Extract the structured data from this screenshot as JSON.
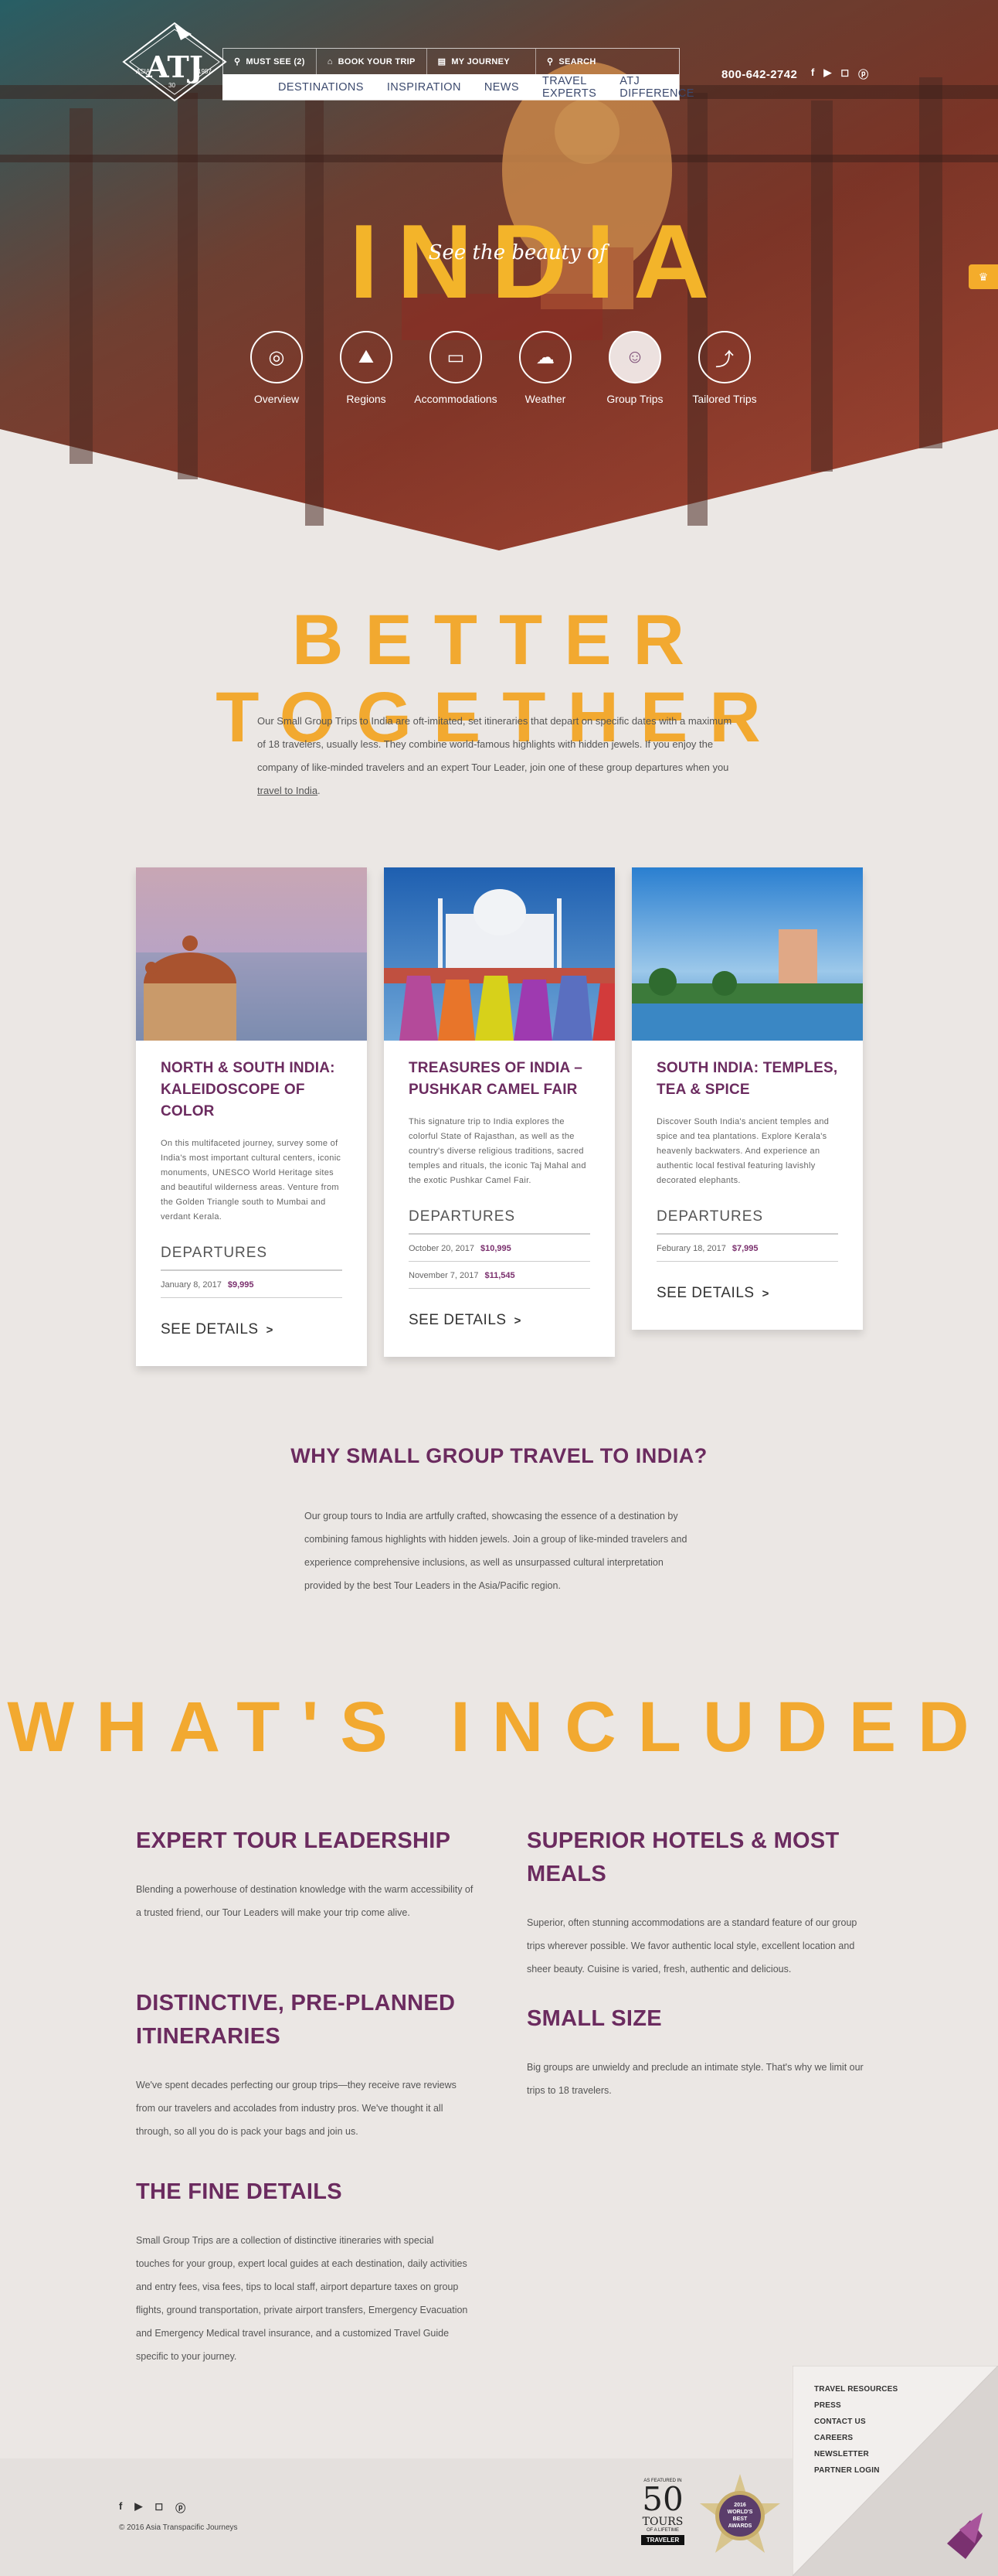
{
  "nav": {
    "top": [
      "MUST SEE (2)",
      "BOOK YOUR TRIP",
      "MY JOURNEY"
    ],
    "search_label": "SEARCH",
    "main": [
      "DESTINATIONS",
      "INSPIRATION",
      "NEWS",
      "TRAVEL EXPERTS",
      "ATJ DIFFERENCE"
    ]
  },
  "logo": {
    "text": "ATJ",
    "left": "ASIA",
    "right": "1987",
    "bottom": "30"
  },
  "phone": "800-642-2742",
  "hero": {
    "title": "INDIA",
    "subtitle": "See the beauty of",
    "icons": [
      {
        "label": "Overview",
        "icon": "globe-icon",
        "glyph": "◎"
      },
      {
        "label": "Regions",
        "icon": "mountains-icon",
        "glyph": "⛰"
      },
      {
        "label": "Accommodations",
        "icon": "bed-icon",
        "glyph": "▭"
      },
      {
        "label": "Weather",
        "icon": "cloud-sun-icon",
        "glyph": "☁"
      },
      {
        "label": "Group Trips",
        "icon": "group-icon",
        "glyph": "☺"
      },
      {
        "label": "Tailored Trips",
        "icon": "route-icon",
        "glyph": "⤴"
      }
    ]
  },
  "better": {
    "heading": "BETTER TOGETHER",
    "text": "Our Small Group Trips to India are oft-imitated, set itineraries that depart on specific dates with a maximum of 18 travelers, usually less. They combine world-famous highlights with hidden jewels. If you enjoy the company of like-minded travelers and an expert Tour Leader, join one of these group departures when you",
    "link": "travel to India",
    "end": "."
  },
  "cards": [
    {
      "title": "NORTH & SOUTH INDIA: KALEIDOSCOPE OF COLOR",
      "text": "On this multifaceted journey, survey some of India's most important cultural centers, iconic monuments, UNESCO World Heritage sites and beautiful wilderness areas. Venture from the Golden Triangle south to Mumbai and verdant Kerala.",
      "departures_label": "DEPARTURES",
      "departures": [
        {
          "date": "January 8, 2017",
          "price": "$9,995"
        }
      ],
      "cta": "SEE DETAILS"
    },
    {
      "title": "TREASURES OF INDIA – PUSHKAR CAMEL FAIR",
      "text": "This signature trip to India explores the colorful State of Rajasthan, as well as the country's diverse religious traditions, sacred temples and rituals, the iconic Taj Mahal and the exotic Pushkar Camel Fair.",
      "departures_label": "DEPARTURES",
      "departures": [
        {
          "date": "October 20, 2017",
          "price": "$10,995"
        },
        {
          "date": "November 7, 2017",
          "price": "$11,545"
        }
      ],
      "cta": "SEE DETAILS"
    },
    {
      "title": "SOUTH INDIA: TEMPLES, TEA & SPICE",
      "text": "Discover South India's ancient temples and spice and tea plantations. Explore Kerala's heavenly backwaters. And experience an authentic local festival featuring lavishly decorated elephants.",
      "departures_label": "DEPARTURES",
      "departures": [
        {
          "date": "Feburary 18, 2017",
          "price": "$7,995"
        }
      ],
      "cta": "SEE DETAILS"
    }
  ],
  "why": {
    "heading": "WHY SMALL GROUP TRAVEL TO INDIA?",
    "text": "Our group tours to India are artfully crafted, showcasing the essence of a destination by combining famous highlights with hidden jewels. Join a group of like-minded travelers and experience comprehensive inclusions, as well as unsurpassed cultural interpretation provided by the best Tour Leaders in the Asia/Pacific region."
  },
  "included": {
    "heading": "WHAT'S INCLUDED",
    "items": [
      {
        "title": "EXPERT TOUR LEADERSHIP",
        "text": "Blending a powerhouse of destination knowledge with the warm accessibility of a trusted friend, our Tour Leaders will make your trip come alive."
      },
      {
        "title": "SUPERIOR HOTELS & MOST MEALS",
        "text": "Superior, often stunning accommodations are a standard feature of our group trips wherever possible. We favor authentic local style, excellent location and sheer beauty. Cuisine is varied, fresh, authentic and delicious."
      },
      {
        "title": "DISTINCTIVE, PRE-PLANNED ITINERARIES",
        "text": "We've spent decades perfecting our group trips—they receive rave reviews from our travelers and accolades from industry pros. We've thought it all through, so all you do is pack your bags and join us."
      },
      {
        "title": "SMALL SIZE",
        "text": "Big groups are unwieldy and preclude an intimate style. That's why we limit our trips to 18 travelers."
      },
      {
        "title": "THE FINE DETAILS",
        "text": "Small Group Trips are a collection of distinctive itineraries with special touches for your group, expert local guides at each destination, daily activities and entry fees, visa fees, tips to local staff, airport departure taxes on group flights, ground transportation, private airport transfers, Emergency Evacuation and Emergency Medical travel insurance, and a customized Travel Guide specific to your journey."
      }
    ]
  },
  "footer": {
    "copyright": "© 2016 Asia Transpacific Journeys",
    "links": [
      "TRAVEL RESOURCES",
      "PRESS",
      "CONTACT US",
      "CAREERS",
      "NEWSLETTER",
      "PARTNER LOGIN"
    ],
    "badge_top": "AS FEATURED IN",
    "badge_num": "50",
    "badge_word": "TOURS",
    "badge_sub": "OF A LIFETIME",
    "badge_mag": "TRAVELER",
    "award_top": "2016",
    "award_lines": [
      "WORLD'S",
      "BEST",
      "AWARDS"
    ]
  },
  "colors": {
    "accent": "#f2a930",
    "plum": "#6b2b5f",
    "bg": "#ebe7e4"
  }
}
